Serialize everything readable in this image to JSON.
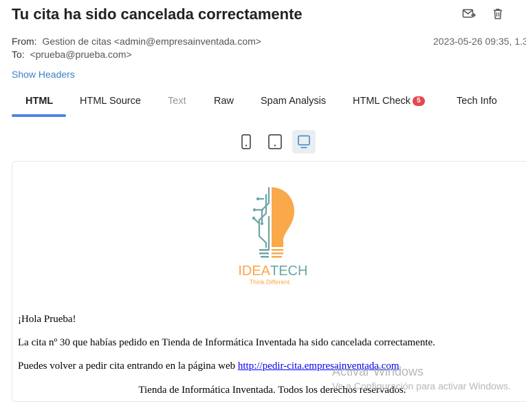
{
  "email": {
    "subject": "Tu cita ha sido cancelada correctamente",
    "from_label": "From:",
    "from_value": "Gestion de citas <admin@empresainventada.com>",
    "to_label": "To:",
    "to_value": "<prueba@prueba.com>",
    "date": "2023-05-26 09:35, 1.3",
    "show_headers": "Show Headers"
  },
  "actions": {
    "forward_icon": "mail-forward-icon",
    "delete_icon": "trash-icon"
  },
  "tabs": [
    {
      "label": "HTML",
      "state": "active"
    },
    {
      "label": "HTML Source",
      "state": "normal"
    },
    {
      "label": "Text",
      "state": "disabled"
    },
    {
      "label": "Raw",
      "state": "normal"
    },
    {
      "label": "Spam Analysis",
      "state": "normal"
    },
    {
      "label": "HTML Check",
      "state": "normal",
      "badge": "5"
    },
    {
      "label": "Tech Info",
      "state": "normal"
    }
  ],
  "device_preview": {
    "icons": [
      "mobile-icon",
      "tablet-icon",
      "desktop-icon"
    ],
    "selected": "desktop"
  },
  "body": {
    "logo_name": "IDEA",
    "logo_name2": "TECH",
    "logo_tagline": "Think Different.",
    "greeting": "¡Hola Prueba!",
    "message": "La cita nº 30 que habías pedido en Tienda de Informática Inventada ha sido cancelada correctamente.",
    "link_prefix": "Puedes volver a pedir cita entrando en la página web ",
    "link_text": "http://pedir-cita.empresainventada.com",
    "footer": "Tienda de Informática Inventada. Todos los derechos reservados."
  },
  "watermark": {
    "line1": "Activar Windows",
    "line2": "Ve a Configuración para activar Windows."
  },
  "colors": {
    "accent": "#4a86e8",
    "badge": "#e5484d",
    "logo_orange": "#f9a84a",
    "logo_teal": "#6aa6a6"
  }
}
